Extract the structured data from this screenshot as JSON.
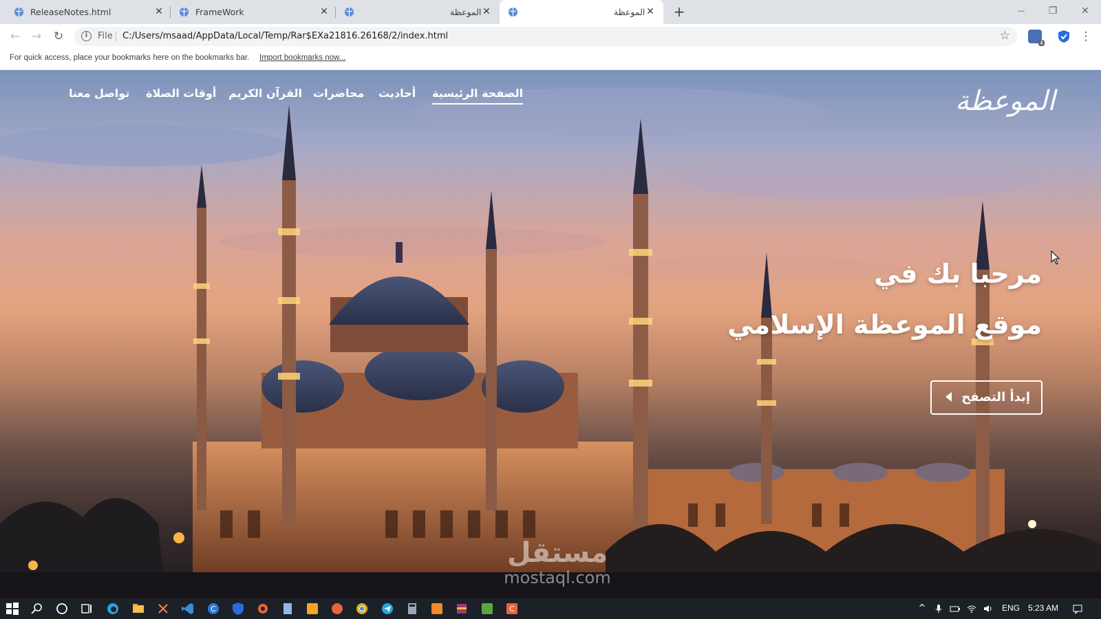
{
  "browser": {
    "tabs": [
      {
        "title": "ReleaseNotes.html",
        "active": false
      },
      {
        "title": "FrameWork",
        "active": false
      },
      {
        "title": "الموعظة",
        "active": false
      },
      {
        "title": "الموعظة",
        "active": true
      }
    ],
    "new_tab_label": "+",
    "window_controls": {
      "minimize": "—",
      "restore": "❐",
      "close": "✕"
    },
    "nav": {
      "back": "←",
      "forward": "→",
      "reload": "↻"
    },
    "address": {
      "scheme_label": "File",
      "url": "C:/Users/msaad/AppData/Local/Temp/Rar$EXa21816.26168/2/index.html",
      "info_icon": "i",
      "bookmark_star": "☆"
    },
    "extensions_badge": "4",
    "menu_icon": "⋮",
    "bookmarks_bar": {
      "message": "For quick access, place your bookmarks here on the bookmarks bar.",
      "import_link": "Import bookmarks now..."
    }
  },
  "site": {
    "logo_text": "الموعظة",
    "nav_items": [
      {
        "label": "الصفحة الرئيسية",
        "active": true
      },
      {
        "label": "أحاديث",
        "active": false
      },
      {
        "label": "محاضرات",
        "active": false
      },
      {
        "label": "القرآن الكريم",
        "active": false
      },
      {
        "label": "أوقات الصلاة",
        "active": false
      },
      {
        "label": "تواصل معنا",
        "active": false
      }
    ],
    "hero": {
      "title_line1": "مرحبا بك في",
      "title_line2": "موقع الموعظة الإسلامي",
      "cta_label": "إبدأ التصفح"
    },
    "watermark": {
      "arabic": "مستقل",
      "latin": "mostaql.com"
    }
  },
  "taskbar": {
    "language": "ENG",
    "time": "5:23 AM",
    "tray_up_arrow": "^",
    "icons": [
      "windows-start-icon",
      "search-icon",
      "cortana-icon",
      "task-view-icon",
      "edge-icon",
      "file-explorer-icon",
      "snipping-tool-icon",
      "visual-studio-code-icon",
      "app-c-icon",
      "shield-app-icon",
      "settings-app-icon",
      "notepad-icon",
      "sublime-text-icon",
      "app-orange-icon",
      "chrome-icon",
      "telegram-icon",
      "calculator-icon",
      "app-orange2-icon",
      "winrar-icon",
      "camtasia-icon",
      "app-c2-icon"
    ]
  },
  "colors": {
    "tab_strip_bg": "#dee1e6",
    "taskbar_bg": "#1c2128",
    "text_white": "#ffffff"
  }
}
